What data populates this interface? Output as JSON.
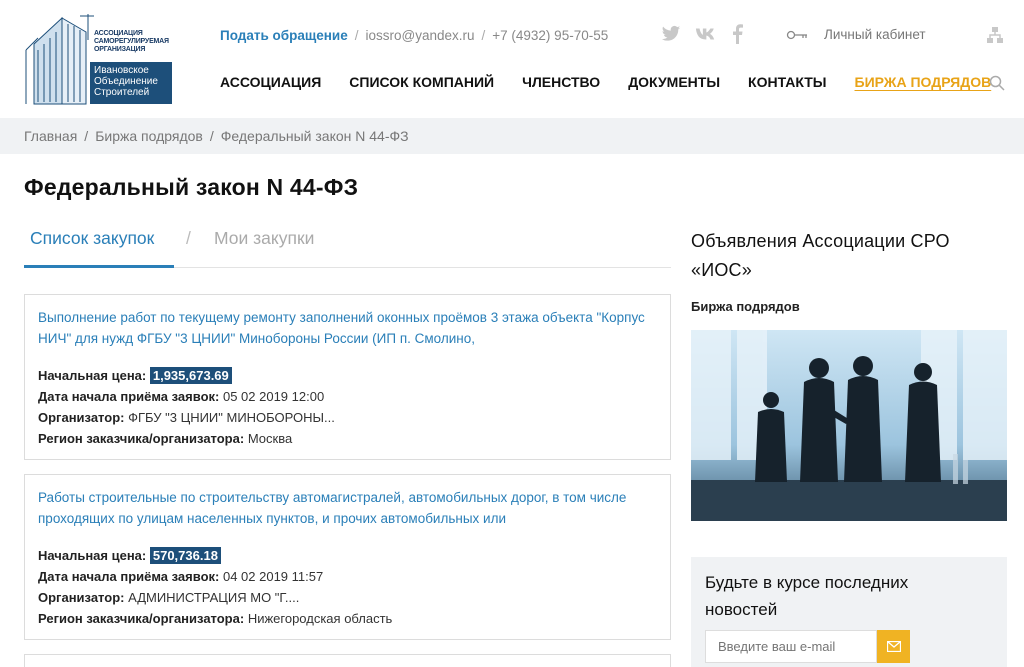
{
  "header": {
    "logo": {
      "small_text": [
        "Ассоциация",
        "саморегулируемая",
        "организация"
      ],
      "plate_text": [
        "Ивановское",
        "Объединение",
        "Строителей"
      ]
    },
    "top_links": {
      "cta": "Подать обращение",
      "email": "iossro@yandex.ru",
      "phone": "+7 (4932) 95-70-55"
    },
    "socials": [
      "twitter-icon",
      "vk-icon",
      "facebook-icon"
    ],
    "cabinet_label": "Личный кабинет",
    "nav": [
      "АССОЦИАЦИЯ",
      "СПИСОК КОМПАНИЙ",
      "ЧЛЕНСТВО",
      "ДОКУМЕНТЫ",
      "КОНТАКТЫ"
    ],
    "nav_active": "БИРЖА ПОДРЯДОВ"
  },
  "breadcrumb": [
    "Главная",
    "Биржа подрядов",
    "Федеральный закон N 44-ФЗ"
  ],
  "page_title": "Федеральный закон N 44-ФЗ",
  "tabs": {
    "active": "Список закупок",
    "separator": "/",
    "inactive": "Мои закупки"
  },
  "labels": {
    "price": "Начальная цена:",
    "date": "Дата начала приёма заявок:",
    "organizer": "Организатор:",
    "region": "Регион заказчика/организатора:"
  },
  "purchases": [
    {
      "title": "Выполнение работ по текущему ремонту заполнений оконных проёмов 3 этажа объекта \"Корпус НИЧ\" для нужд ФГБУ \"3 ЦНИИ\" Минобороны России (ИП п. Смолино,",
      "price": "1,935,673.69",
      "date": "05 02 2019 12:00",
      "organizer": "ФГБУ \"3 ЦНИИ\" МИНОБОРОНЫ...",
      "region": "Москва"
    },
    {
      "title": "Работы строительные по строительству автомагистралей, автомобильных дорог, в том числе проходящих по улицам населенных пунктов, и прочих автомобильных или",
      "price": "570,736.18",
      "date": "04 02 2019 11:57",
      "organizer": "АДМИНИСТРАЦИЯ МО \"Г....",
      "region": "Нижегородская область"
    }
  ],
  "sidebar": {
    "title": "Объявления Ассоциации СРО «ИОС»",
    "subtitle": "Биржа подрядов",
    "news_title": "Будьте в курсе последних новостей",
    "email_placeholder": "Введите ваш e-mail"
  },
  "colors": {
    "accent_blue": "#2a7fb8",
    "accent_orange": "#e8a317",
    "price_bg": "#1d4f7a"
  }
}
